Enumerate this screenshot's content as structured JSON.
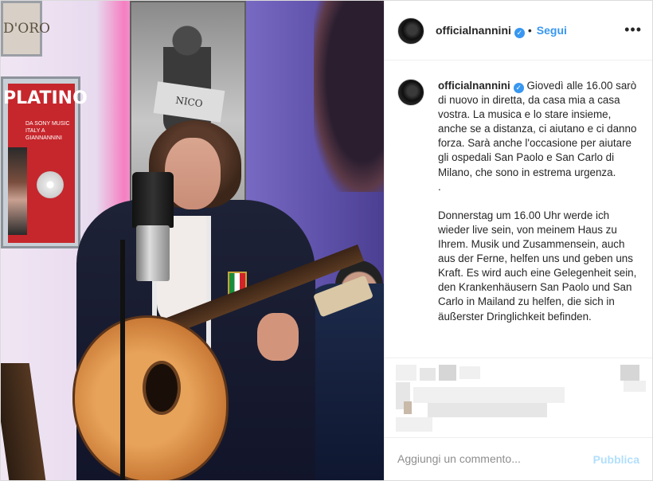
{
  "post": {
    "username": "officialnannini",
    "verified_mark": "✓",
    "separator": "•",
    "follow_label": "Segui",
    "more_icon": "•••",
    "caption": "Giovedì alle 16.00 sarò di nuovo in diretta, da casa mia a casa vostra. La musica e lo stare insieme, anche se a distanza, ci aiutano e ci danno forza. Sarà anche l'occasione per aiutare gli ospedali San Paolo e San Carlo di Milano, che sono in estrema urgenza.\n.\n\nDonnerstag um 16.00 Uhr werde ich wieder live sein, von meinem Haus zu Ihrem. Musik und Zusammensein, auch aus der Ferne, helfen uns und geben uns Kraft. Es wird auch eine Gelegenheit sein, den Krankenhäusern San Paolo und San Carlo in Mailand zu helfen, die sich in äußerster Dringlichkeit befinden."
  },
  "photo": {
    "doro_text": "D'ORO",
    "platino_text": "PLATINO",
    "platino_sub": "DA SONY MUSIC ITALY A GIANNANNINI",
    "poster_sign": "NICO",
    "accent_colors": {
      "link": "#3897f0",
      "publish_disabled": "#b2dffc",
      "text": "#262626",
      "placeholder": "#8e8e8e"
    }
  },
  "comment": {
    "placeholder": "Aggiungi un commento...",
    "publish_label": "Pubblica"
  }
}
